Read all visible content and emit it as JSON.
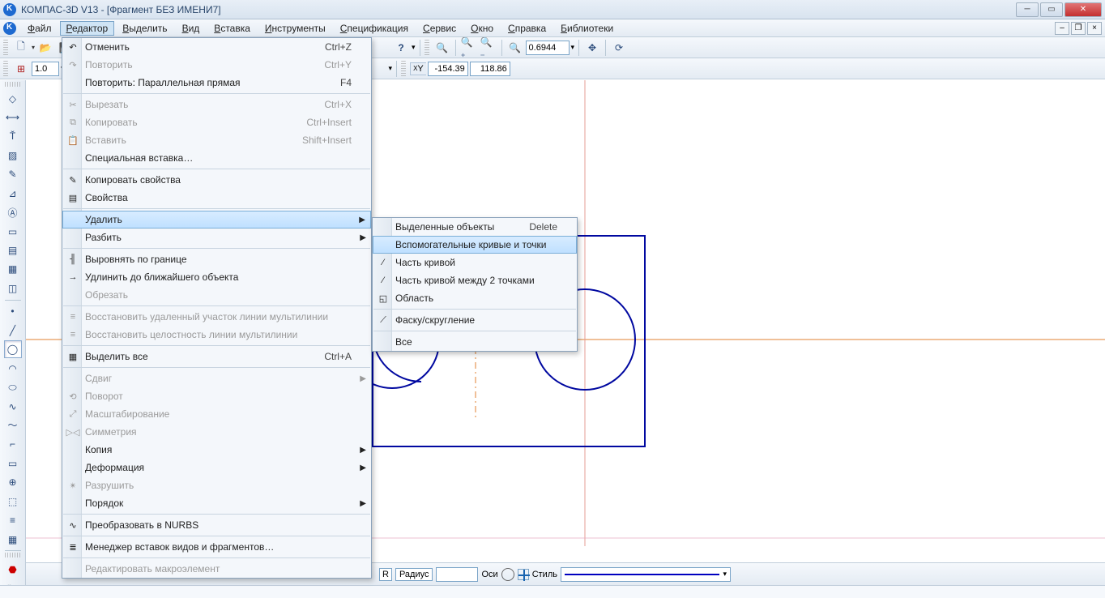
{
  "title": "КОМПАС-3D V13 - [Фрагмент БЕЗ ИМЕНИ7]",
  "menubar": [
    "Файл",
    "Редактор",
    "Выделить",
    "Вид",
    "Вставка",
    "Инструменты",
    "Спецификация",
    "Сервис",
    "Окно",
    "Справка",
    "Библиотеки"
  ],
  "active_menu_index": 1,
  "toolbar2": {
    "val": "1.0"
  },
  "toolbar_zoom": {
    "value": "0.6944"
  },
  "coords": {
    "x_label": "X",
    "y_label": "Y",
    "x": "-154.39",
    "y": "118.86"
  },
  "main_menu": [
    {
      "label": "Отменить",
      "shortcut": "Ctrl+Z",
      "icon": "↶"
    },
    {
      "label": "Повторить",
      "shortcut": "Ctrl+Y",
      "icon": "↷",
      "disabled": true
    },
    {
      "label": "Повторить: Параллельная прямая",
      "shortcut": "F4"
    },
    {
      "sep": true
    },
    {
      "label": "Вырезать",
      "shortcut": "Ctrl+X",
      "icon": "✂",
      "disabled": true
    },
    {
      "label": "Копировать",
      "shortcut": "Ctrl+Insert",
      "icon": "⧉",
      "disabled": true
    },
    {
      "label": "Вставить",
      "shortcut": "Shift+Insert",
      "icon": "📋",
      "disabled": true
    },
    {
      "label": "Специальная вставка…"
    },
    {
      "sep": true
    },
    {
      "label": "Копировать свойства",
      "icon": "✎"
    },
    {
      "label": "Свойства",
      "icon": "▤"
    },
    {
      "sep": true
    },
    {
      "label": "Удалить",
      "sub": true,
      "highlight": true
    },
    {
      "label": "Разбить",
      "sub": true
    },
    {
      "sep": true
    },
    {
      "label": "Выровнять по границе",
      "icon": "╢"
    },
    {
      "label": "Удлинить до ближайшего объекта",
      "icon": "→"
    },
    {
      "label": "Обрезать",
      "disabled": true
    },
    {
      "sep": true
    },
    {
      "label": "Восстановить удаленный участок линии мультилинии",
      "icon": "≡",
      "disabled": true
    },
    {
      "label": "Восстановить целостность линии мультилинии",
      "icon": "≡",
      "disabled": true
    },
    {
      "sep": true
    },
    {
      "label": "Выделить все",
      "shortcut": "Ctrl+A",
      "icon": "▦"
    },
    {
      "sep": true
    },
    {
      "label": "Сдвиг",
      "sub": true,
      "disabled": true
    },
    {
      "label": "Поворот",
      "icon": "⟲",
      "disabled": true
    },
    {
      "label": "Масштабирование",
      "icon": "⤢",
      "disabled": true
    },
    {
      "label": "Симметрия",
      "icon": "▷◁",
      "disabled": true
    },
    {
      "label": "Копия",
      "sub": true
    },
    {
      "label": "Деформация",
      "sub": true
    },
    {
      "label": "Разрушить",
      "icon": "✴",
      "disabled": true
    },
    {
      "label": "Порядок",
      "sub": true
    },
    {
      "sep": true
    },
    {
      "label": "Преобразовать в NURBS",
      "icon": "∿"
    },
    {
      "sep": true
    },
    {
      "label": "Менеджер вставок видов и фрагментов…",
      "icon": "≣"
    },
    {
      "sep": true
    },
    {
      "label": "Редактировать макроэлемент",
      "disabled": true
    }
  ],
  "sub_menu": [
    {
      "label": "Выделенные объекты",
      "shortcut": "Delete"
    },
    {
      "label": "Вспомогательные кривые и точки",
      "highlight": true
    },
    {
      "label": "Часть кривой",
      "icon": "⁄"
    },
    {
      "label": "Часть кривой между 2 точками",
      "icon": "⁄"
    },
    {
      "label": "Область",
      "icon": "◱"
    },
    {
      "sep": true
    },
    {
      "label": "Фаску/скругление",
      "icon": "⟋"
    },
    {
      "sep": true
    },
    {
      "label": "Все"
    }
  ],
  "prop_bar": {
    "r_label": "R",
    "radius_label": "Радиус",
    "axes_label": "Оси",
    "style_label": "Стиль"
  }
}
